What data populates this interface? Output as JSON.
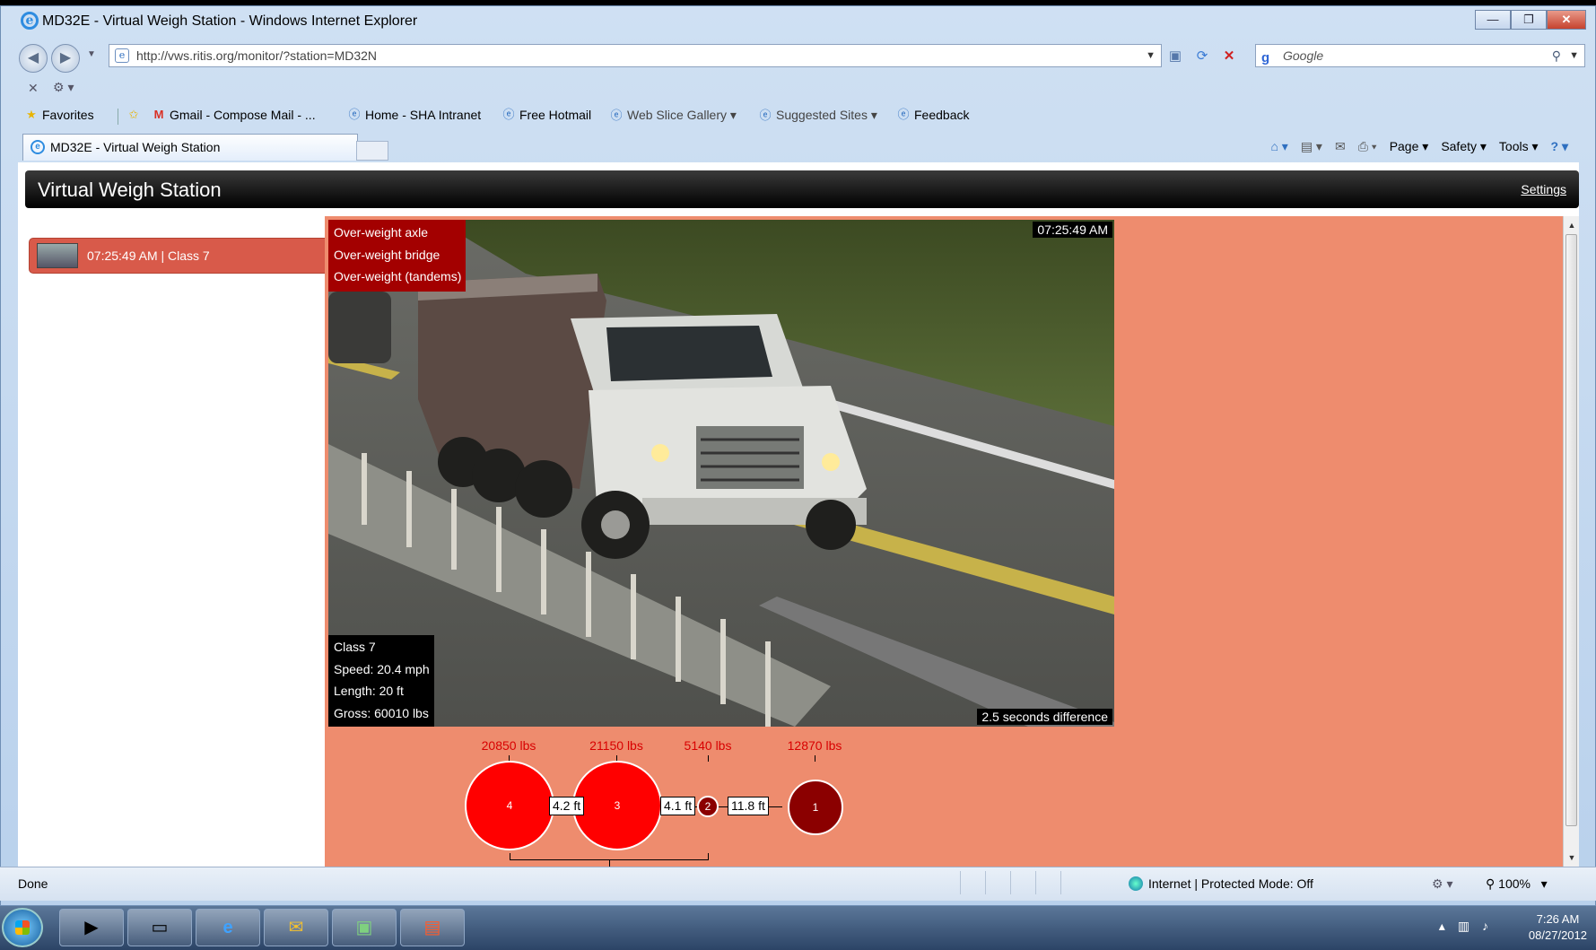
{
  "window": {
    "title": "MD32E - Virtual Weigh Station - Windows Internet Explorer",
    "controls": [
      "—",
      "❐",
      "✕"
    ]
  },
  "address": {
    "url": "http://vws.ritis.org/monitor/?station=MD32N",
    "search_placeholder": "Google"
  },
  "favorites_bar": {
    "favorites_label": "Favorites",
    "items": [
      {
        "label": "Gmail - Compose Mail - ...",
        "icon": "gmail-icon"
      },
      {
        "label": "Home - SHA Intranet",
        "icon": "ie-page-icon"
      },
      {
        "label": "Free Hotmail",
        "icon": "ie-page-icon"
      },
      {
        "label": "Web Slice Gallery ▾",
        "icon": "ie-page-icon"
      },
      {
        "label": "Suggested Sites ▾",
        "icon": "ie-page-icon"
      },
      {
        "label": "Feedback",
        "icon": "ie-page-icon"
      }
    ]
  },
  "tab": {
    "label": "MD32E - Virtual Weigh Station"
  },
  "commandbar": {
    "page": "Page ▾",
    "safety": "Safety ▾",
    "tools": "Tools ▾"
  },
  "app": {
    "title": "Virtual Weigh Station",
    "settings_label": "Settings"
  },
  "event_list": [
    {
      "label": "07:25:49 AM | Class 7"
    }
  ],
  "event": {
    "violations": [
      "Over-weight axle",
      "Over-weight bridge",
      "Over-weight (tandems)"
    ],
    "timestamp": "07:25:49 AM",
    "stats": [
      "Class 7",
      "Speed: 20.4 mph",
      "Length: 20 ft",
      "Gross: 60010 lbs"
    ],
    "time_difference": "2.5 seconds difference"
  },
  "axles": {
    "weights": [
      "20850 lbs",
      "21150 lbs",
      "5140 lbs",
      "12870 lbs"
    ],
    "numbers": [
      "4",
      "3",
      "2",
      "1"
    ],
    "spacings": [
      "4.2 ft",
      "4.1 ft",
      "11.8 ft"
    ],
    "overweight_color": "#ff0000",
    "normal_color": "#8b0000"
  },
  "status": {
    "left": "Done",
    "zone": "Internet | Protected Mode: Off",
    "zoom": "100%"
  },
  "taskbar": {
    "time": "7:26 AM",
    "date": "08/27/2012"
  },
  "colors": {
    "alert_background": "#ee8c6e",
    "event_item": "#d85a4a",
    "violation_box": "#a30000"
  }
}
